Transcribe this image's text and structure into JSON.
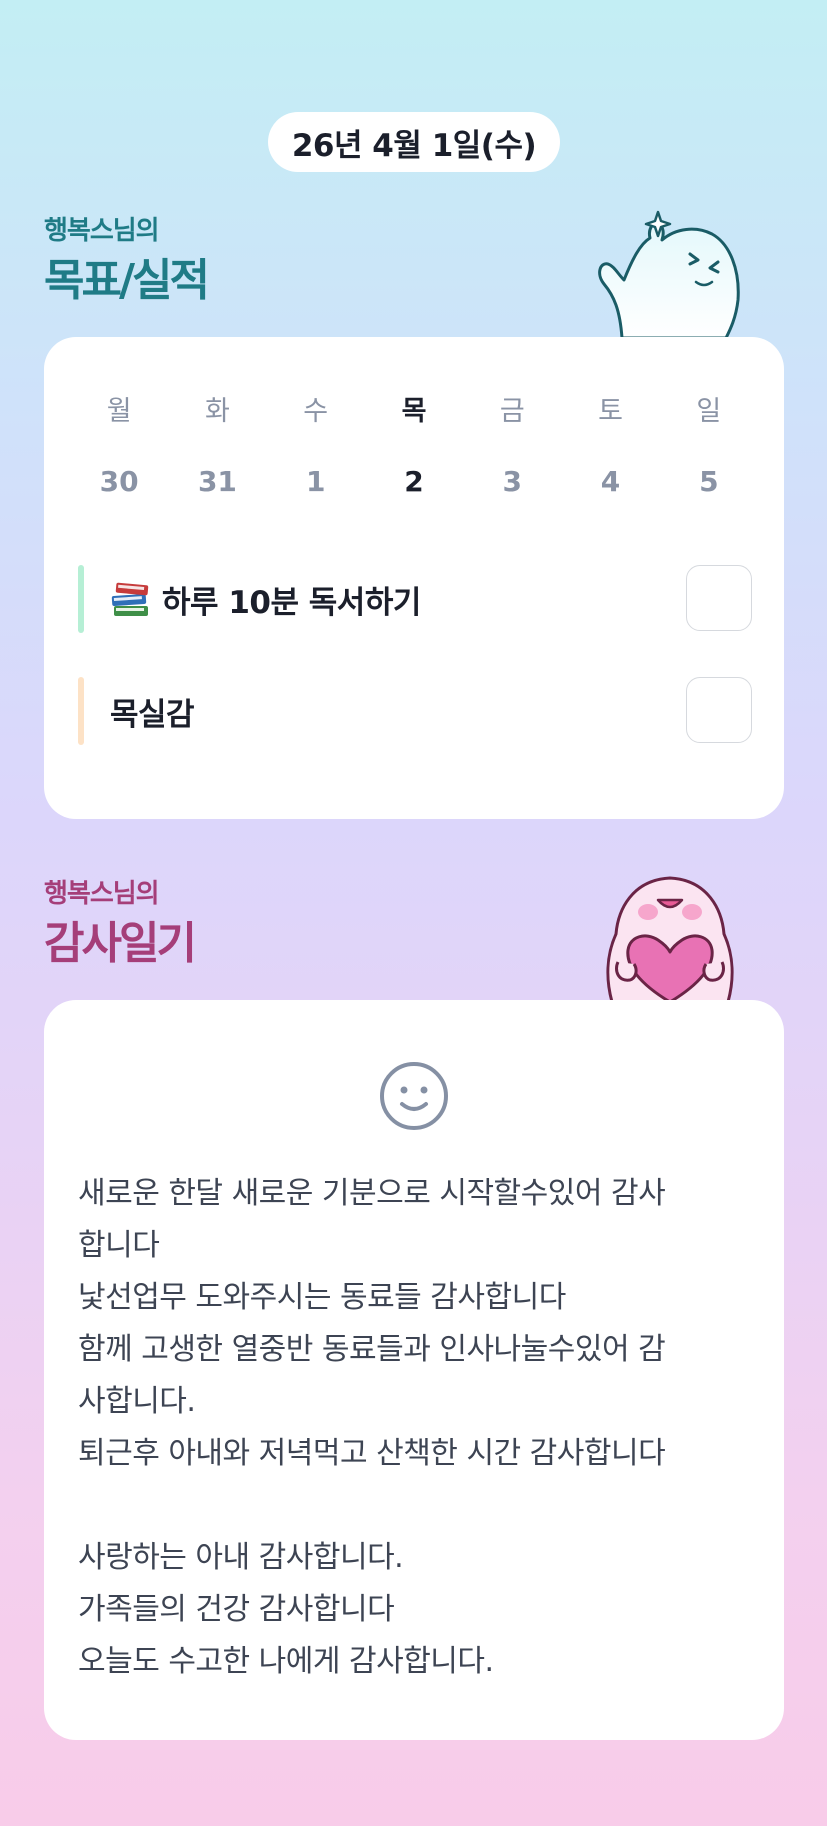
{
  "date_label": "26년 4월 1일(수)",
  "goals_section": {
    "subtitle": "행복스님의",
    "title": "목표/실적",
    "day_names": [
      "월",
      "화",
      "수",
      "목",
      "금",
      "토",
      "일"
    ],
    "day_numbers": [
      "30",
      "31",
      "1",
      "2",
      "3",
      "4",
      "5"
    ],
    "today_index": 3,
    "goals": [
      {
        "label": "하루 10분 독서하기",
        "icon": "books-icon",
        "bar_color": "#b6efd5",
        "checked": false
      },
      {
        "label": "목실감",
        "icon": "",
        "bar_color": "#fde2c6",
        "checked": false
      }
    ]
  },
  "gratitude_section": {
    "subtitle": "행복스님의",
    "title": "감사일기",
    "mood_icon": "smiley-icon",
    "lines": [
      "새로운 한달 새로운 기분으로 시작할수있어 감사",
      "합니다",
      "낯선업무 도와주시는 동료들 감사합니다",
      "함께 고생한 열중반 동료들과 인사나눌수있어 감",
      "사합니다.",
      "퇴근후 아내와 저녁먹고 산책한 시간 감사합니다",
      "",
      "사랑하는 아내 감사합니다.",
      "가족들의 건강 감사합니다",
      "오늘도 수고한 나에게 감사합니다."
    ]
  },
  "colors": {
    "teal_heading": "#1f7b86",
    "plum_heading": "#a53e79",
    "gradient_top": "#c3eef4",
    "gradient_bottom": "#f8cce9"
  }
}
